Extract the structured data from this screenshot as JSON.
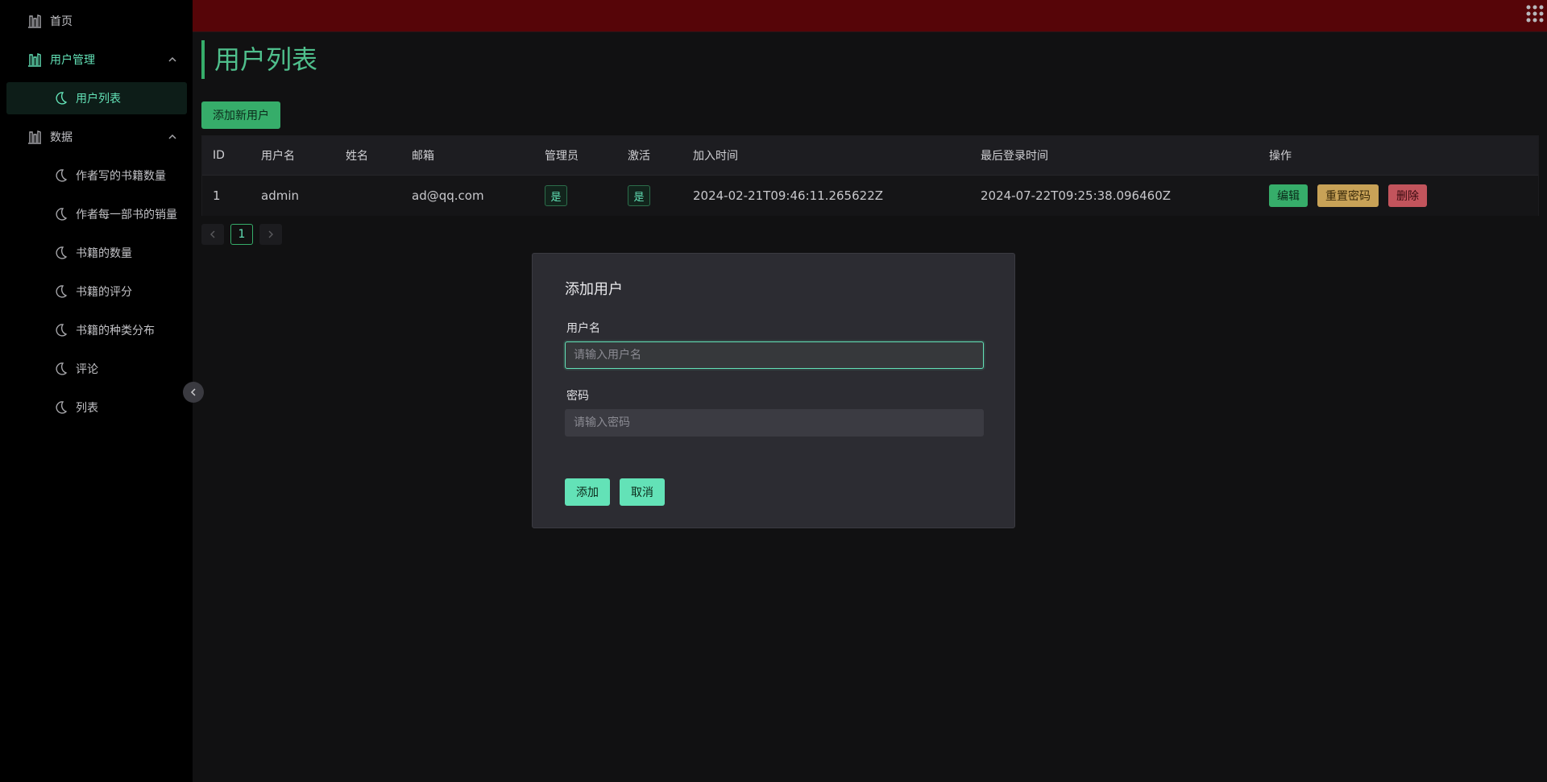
{
  "colors": {
    "accent": "#63e2b7",
    "primary": "#36ad6a",
    "topbar": "#560508",
    "warning": "#c8a257",
    "danger": "#c2545c"
  },
  "sidebar": {
    "items": [
      {
        "label": "首页",
        "icon": "chart-icon"
      },
      {
        "label": "用户管理",
        "icon": "chart-icon",
        "expanded": true
      },
      {
        "label": "用户列表",
        "icon": "moon-icon",
        "active": true
      },
      {
        "label": "数据",
        "icon": "chart-icon",
        "expanded": true
      },
      {
        "label": "作者写的书籍数量",
        "icon": "moon-icon"
      },
      {
        "label": "作者每一部书的销量",
        "icon": "moon-icon"
      },
      {
        "label": "书籍的数量",
        "icon": "moon-icon"
      },
      {
        "label": "书籍的评分",
        "icon": "moon-icon"
      },
      {
        "label": "书籍的种类分布",
        "icon": "moon-icon"
      },
      {
        "label": "评论",
        "icon": "moon-icon"
      },
      {
        "label": "列表",
        "icon": "moon-icon"
      }
    ]
  },
  "page": {
    "title": "用户列表",
    "add_button": "添加新用户"
  },
  "table": {
    "headers": [
      "ID",
      "用户名",
      "姓名",
      "邮箱",
      "管理员",
      "激活",
      "加入时间",
      "最后登录时间",
      "操作"
    ],
    "rows": [
      {
        "id": "1",
        "username": "admin",
        "name": "",
        "email": "ad@qq.com",
        "admin": "是",
        "active": "是",
        "joined": "2024-02-21T09:46:11.265622Z",
        "last_login": "2024-07-22T09:25:38.096460Z",
        "actions": {
          "edit": "编辑",
          "reset": "重置密码",
          "delete": "删除"
        }
      }
    ]
  },
  "pagination": {
    "current": "1",
    "prev_icon": "chevron-left-icon",
    "next_icon": "chevron-right-icon"
  },
  "modal": {
    "title": "添加用户",
    "username_label": "用户名",
    "username_placeholder": "请输入用户名",
    "password_label": "密码",
    "password_placeholder": "请输入密码",
    "submit": "添加",
    "cancel": "取消"
  }
}
